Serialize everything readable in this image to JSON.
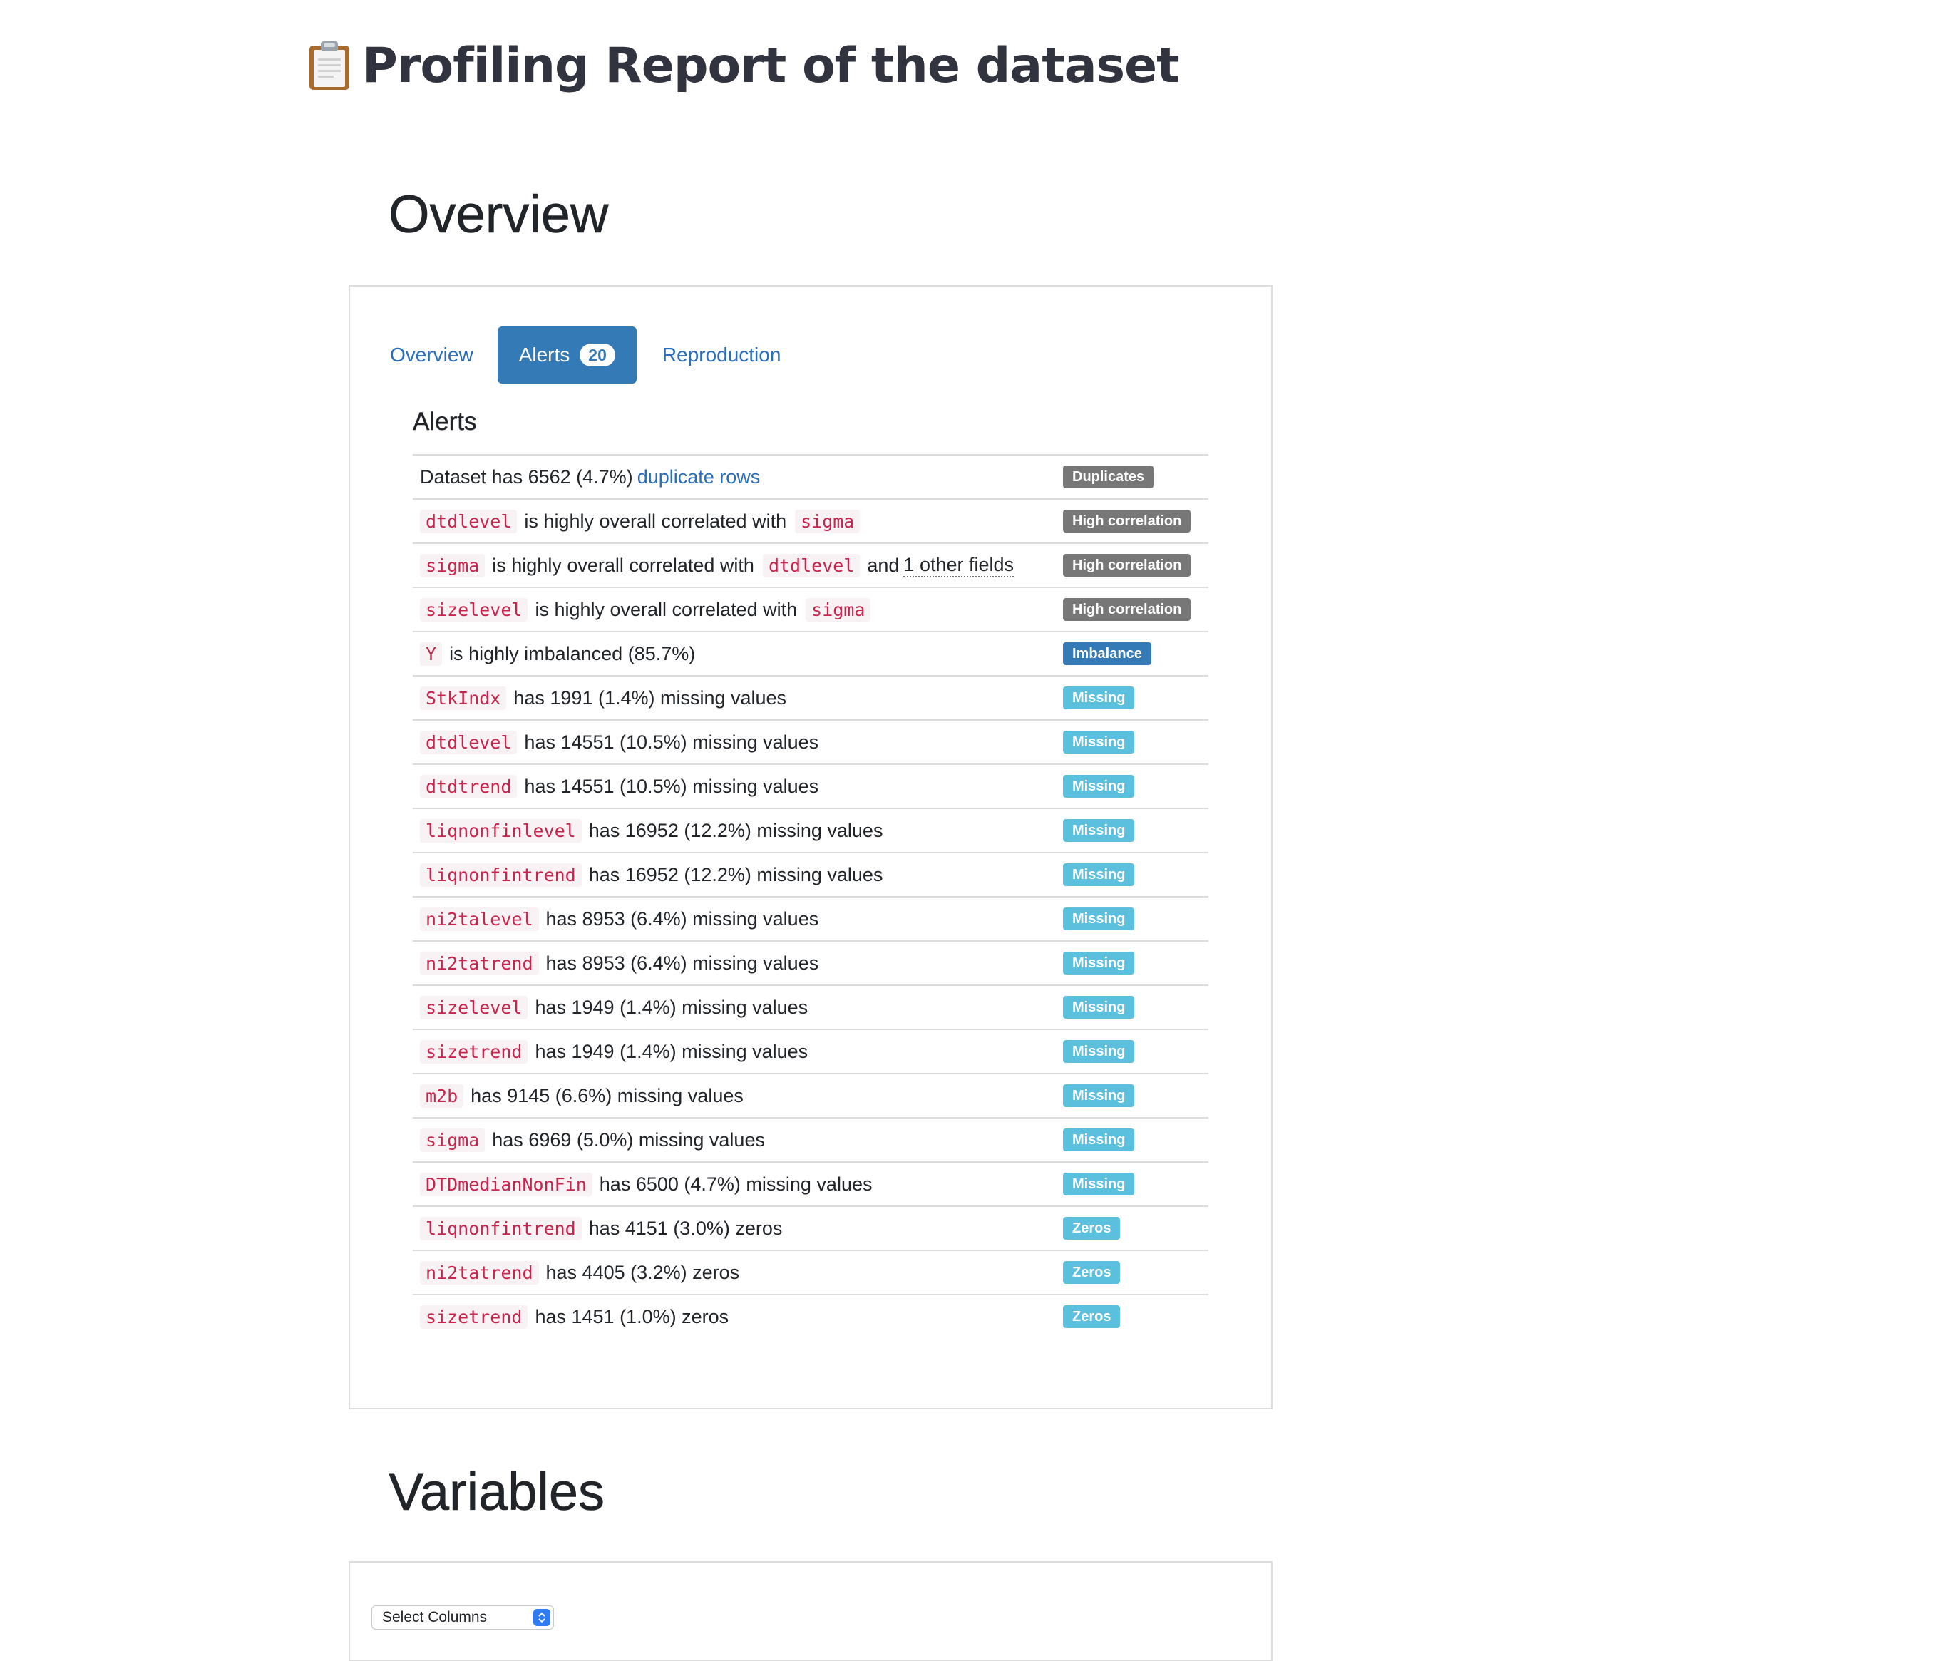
{
  "page": {
    "title": "Profiling Report of the dataset",
    "title_icon": "clipboard-icon"
  },
  "overview": {
    "heading": "Overview",
    "tabs": [
      {
        "label": "Overview",
        "active": false
      },
      {
        "label": "Alerts",
        "active": true,
        "count": "20"
      },
      {
        "label": "Reproduction",
        "active": false
      }
    ],
    "alerts_title": "Alerts",
    "alerts": [
      {
        "type": "duplicates",
        "prefix": "Dataset has 6562 (4.7%)",
        "link": "duplicate rows",
        "label": "Duplicates",
        "style": "default"
      },
      {
        "type": "corr1",
        "field": "dtdlevel",
        "middle": "is highly overall correlated with",
        "field2": "sigma",
        "label": "High correlation",
        "style": "default"
      },
      {
        "type": "corr2",
        "field": "sigma",
        "middle": "is highly overall correlated with",
        "field2": "dtdlevel",
        "and_text": "and",
        "other": "1 other fields",
        "label": "High correlation",
        "style": "default"
      },
      {
        "type": "corr1",
        "field": "sizelevel",
        "middle": "is highly overall correlated with",
        "field2": "sigma",
        "label": "High correlation",
        "style": "default"
      },
      {
        "type": "simple",
        "field": "Y",
        "text": "is highly imbalanced (85.7%)",
        "label": "Imbalance",
        "style": "primary"
      },
      {
        "type": "simple",
        "field": "StkIndx",
        "text": "has 1991 (1.4%) missing values",
        "label": "Missing",
        "style": "info"
      },
      {
        "type": "simple",
        "field": "dtdlevel",
        "text": "has 14551 (10.5%) missing values",
        "label": "Missing",
        "style": "info"
      },
      {
        "type": "simple",
        "field": "dtdtrend",
        "text": "has 14551 (10.5%) missing values",
        "label": "Missing",
        "style": "info"
      },
      {
        "type": "simple",
        "field": "liqnonfinlevel",
        "text": "has 16952 (12.2%) missing values",
        "label": "Missing",
        "style": "info"
      },
      {
        "type": "simple",
        "field": "liqnonfintrend",
        "text": "has 16952 (12.2%) missing values",
        "label": "Missing",
        "style": "info"
      },
      {
        "type": "simple",
        "field": "ni2talevel",
        "text": "has 8953 (6.4%) missing values",
        "label": "Missing",
        "style": "info"
      },
      {
        "type": "simple",
        "field": "ni2tatrend",
        "text": "has 8953 (6.4%) missing values",
        "label": "Missing",
        "style": "info"
      },
      {
        "type": "simple",
        "field": "sizelevel",
        "text": "has 1949 (1.4%) missing values",
        "label": "Missing",
        "style": "info"
      },
      {
        "type": "simple",
        "field": "sizetrend",
        "text": "has 1949 (1.4%) missing values",
        "label": "Missing",
        "style": "info"
      },
      {
        "type": "simple",
        "field": "m2b",
        "text": "has 9145 (6.6%) missing values",
        "label": "Missing",
        "style": "info"
      },
      {
        "type": "simple",
        "field": "sigma",
        "text": "has 6969 (5.0%) missing values",
        "label": "Missing",
        "style": "info"
      },
      {
        "type": "simple",
        "field": "DTDmedianNonFin",
        "text": "has 6500 (4.7%) missing values",
        "label": "Missing",
        "style": "info"
      },
      {
        "type": "simple",
        "field": "liqnonfintrend",
        "text": "has 4151 (3.0%) zeros",
        "label": "Zeros",
        "style": "info"
      },
      {
        "type": "simple",
        "field": "ni2tatrend",
        "text": "has 4405 (3.2%) zeros",
        "label": "Zeros",
        "style": "info"
      },
      {
        "type": "simple",
        "field": "sizetrend",
        "text": "has 1451 (1.0%) zeros",
        "label": "Zeros",
        "style": "info"
      }
    ]
  },
  "variables": {
    "heading": "Variables",
    "select_label": "Select Columns",
    "select_icon": "chevron-updown-icon"
  },
  "colors": {
    "link": "#2a6db8",
    "tab_active": "#337ab7",
    "code_text": "#c7254e",
    "code_bg": "#f9f2f4",
    "label_default": "#777777",
    "label_primary": "#337ab7",
    "label_info": "#5bc0de"
  }
}
